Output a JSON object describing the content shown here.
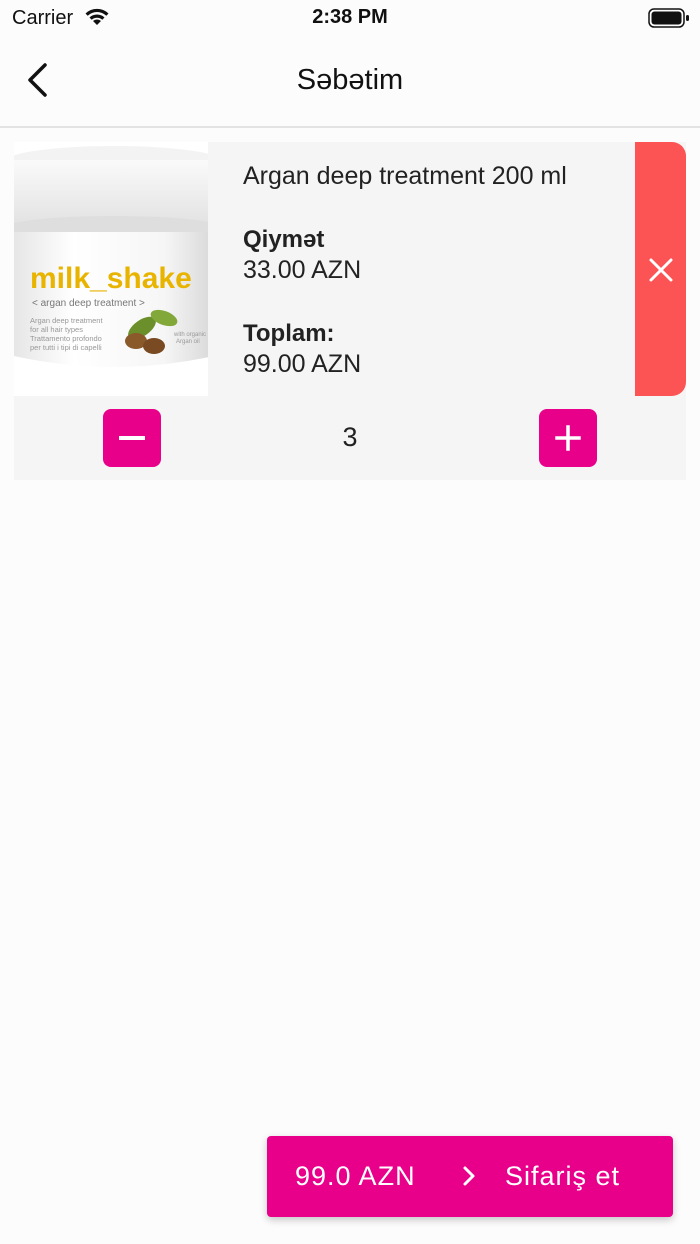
{
  "status_bar": {
    "carrier": "Carrier",
    "time": "2:38 PM"
  },
  "header": {
    "title": "Səbətim"
  },
  "cart": {
    "items": [
      {
        "name": "Argan deep treatment 200 ml",
        "price_label": "Qiymət",
        "price": "33.00 AZN",
        "total_label": "Toplam:",
        "total": "99.00 AZN",
        "quantity": "3",
        "image": {
          "brand": "milk_shake",
          "subtitle": "< argan deep treatment >",
          "line1": "Argan deep treatment",
          "line2": "for all hair types",
          "line3": "Trattamento profondo",
          "line4": "per tutti i tipi di capelli",
          "badge1": "with organic",
          "badge2": "Argan oil"
        }
      }
    ]
  },
  "checkout": {
    "total": "99.0 AZN",
    "label": "Sifariş et"
  },
  "colors": {
    "accent": "#e8008b",
    "delete": "#fc5354",
    "card_bg": "#f5f5f6",
    "page_bg": "#fdfcfd"
  },
  "icons": {
    "back": "chevron-left-icon",
    "delete": "close-icon",
    "minus": "minus-icon",
    "plus": "plus-icon",
    "checkout": "chevron-right-icon"
  }
}
